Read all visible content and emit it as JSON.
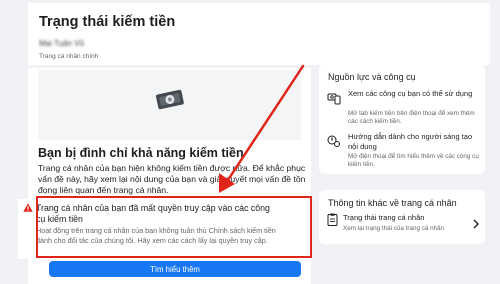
{
  "header": {
    "title": "Trạng thái kiếm tiền",
    "profile_name": "Mai Tuấn Vũ",
    "profile_type": "Trang cá nhân chính"
  },
  "restriction": {
    "title": "Bạn bị đình chỉ khả năng kiếm tiền",
    "description": "Trang cá nhân của bạn hiện không kiếm tiền được nữa. Để khắc phục vấn đề này, hãy xem lại nội dung của bạn và giải quyết mọi vấn đề tồn đọng liên quan đến trang cá nhân."
  },
  "alert": {
    "title": "Trang cá nhân của bạn đã mất quyền truy cập vào các công cụ kiếm tiền",
    "description": "Hoạt động trên trang cá nhân của bạn không tuân thủ Chính sách kiếm tiền dành cho đối tác của chúng tôi. Hãy xem các cách lấy lại quyền truy cập.",
    "button_label": "Tìm hiểu thêm"
  },
  "resources": {
    "title": "Nguồn lực và công cụ",
    "items": [
      {
        "label": "Xem các công cụ bạn có thể sử dụng",
        "description": "Mở tab kiếm tiền trên điện thoại để xem thêm các cách kiếm tiền.",
        "icon": "phone-money-icon"
      },
      {
        "label": "Hướng dẫn dành cho người sáng tạo nội dung",
        "description": "Mở điện thoại để tìm hiểu thêm về các công cụ kiếm tiền.",
        "icon": "creator-guide-icon"
      }
    ]
  },
  "other_info": {
    "title": "Thông tin khác về trang cá nhân",
    "status_label": "Trạng thái trang cá nhân",
    "status_desc": "Xem lại trạng thái của trang cá nhân",
    "icon": "clipboard-icon"
  },
  "colors": {
    "primary": "#1877f2",
    "alert_red": "#e0251b",
    "background": "#f0f2f5",
    "card": "#ffffff",
    "muted_text": "#65676b"
  }
}
